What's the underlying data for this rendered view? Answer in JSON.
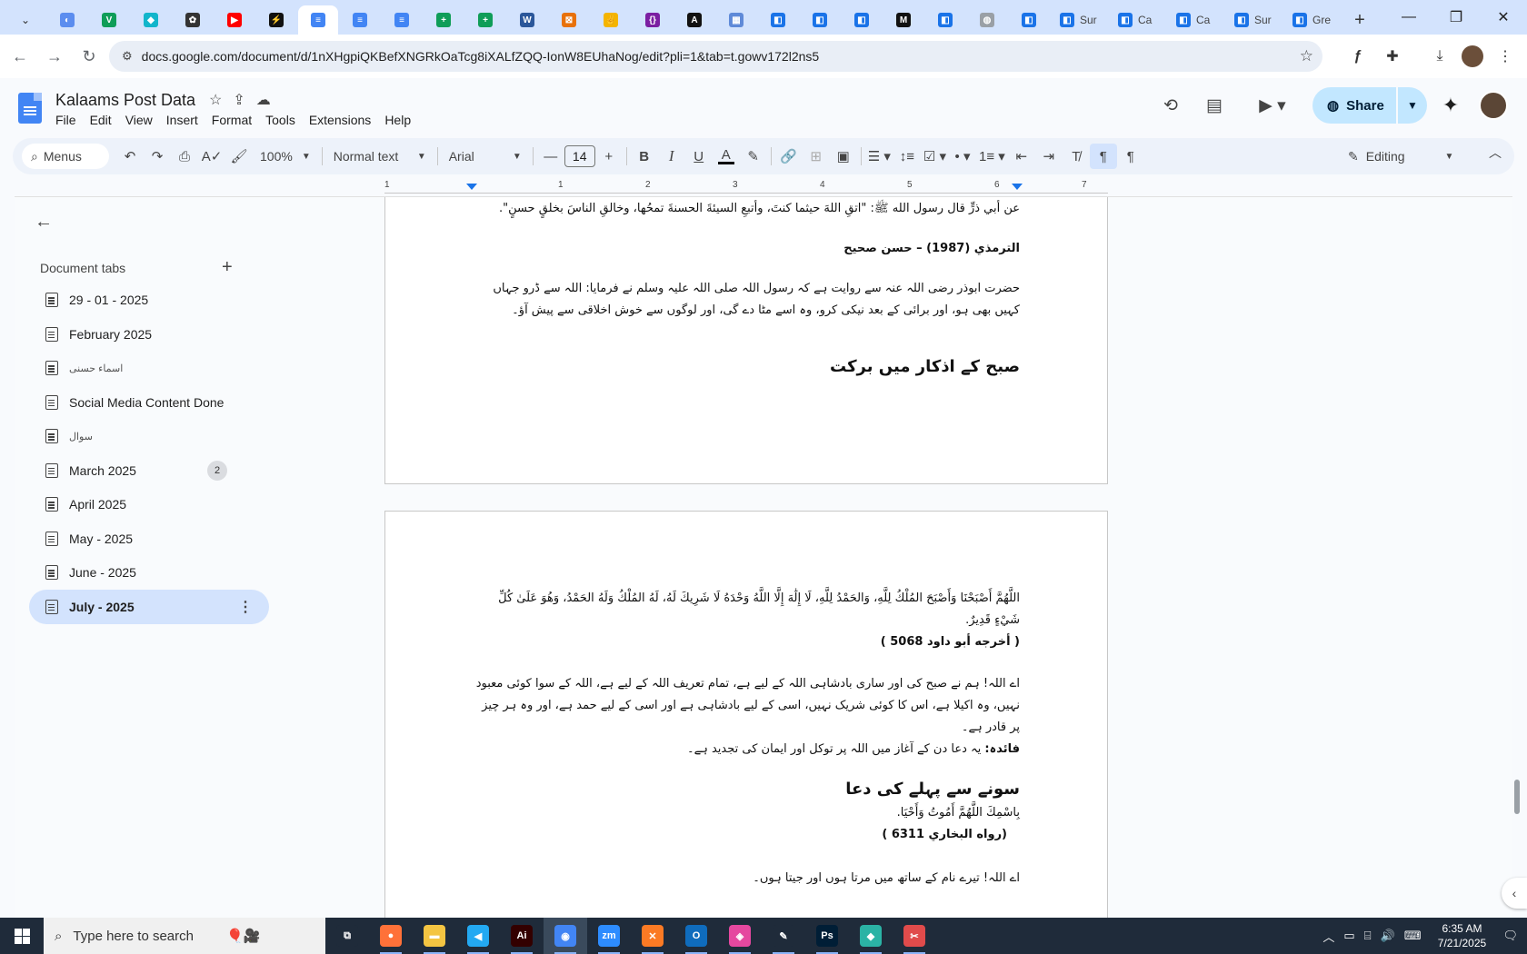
{
  "browser": {
    "tabs": [
      {
        "icon": "globe-sphere-icon",
        "color": "#5b8def",
        "label": "",
        "glyph": "◐"
      },
      {
        "icon": "v-logo-icon",
        "color": "#0f9d58",
        "label": "",
        "glyph": "V"
      },
      {
        "icon": "diamond-logo-icon",
        "color": "#12b5cb",
        "label": "",
        "glyph": "◆"
      },
      {
        "icon": "openai-icon",
        "color": "#333333",
        "label": "",
        "glyph": "✿"
      },
      {
        "icon": "youtube-icon",
        "color": "#ff0000",
        "label": "",
        "glyph": "▶"
      },
      {
        "icon": "bolt-icon",
        "color": "#111111",
        "label": "",
        "glyph": "⚡"
      },
      {
        "icon": "google-docs-icon",
        "color": "#4285f4",
        "label": "",
        "glyph": "≡",
        "active": true
      },
      {
        "icon": "google-docs-icon",
        "color": "#4285f4",
        "label": "",
        "glyph": "≡"
      },
      {
        "icon": "google-docs-icon",
        "color": "#4285f4",
        "label": "",
        "glyph": "≡"
      },
      {
        "icon": "google-sheets-icon",
        "color": "#0f9d58",
        "label": "",
        "glyph": "+"
      },
      {
        "icon": "google-sheets-icon",
        "color": "#0f9d58",
        "label": "",
        "glyph": "+"
      },
      {
        "icon": "word-icon",
        "color": "#2b579a",
        "label": "",
        "glyph": "W"
      },
      {
        "icon": "grid-logo-icon",
        "color": "#e8710a",
        "label": "",
        "glyph": "⊠"
      },
      {
        "icon": "bird-logo-icon",
        "color": "#f4b400",
        "label": "",
        "glyph": "✌"
      },
      {
        "icon": "code-braces-icon",
        "color": "#7b1fa2",
        "label": "",
        "glyph": "{}"
      },
      {
        "icon": "a-logo-icon",
        "color": "#111111",
        "label": "",
        "glyph": "A"
      },
      {
        "icon": "table-icon",
        "color": "#5f8ad8",
        "label": "",
        "glyph": "▦"
      },
      {
        "icon": "forms-icon",
        "color": "#1a73e8",
        "label": "",
        "glyph": "◧"
      },
      {
        "icon": "forms-icon",
        "color": "#1a73e8",
        "label": "",
        "glyph": "◧"
      },
      {
        "icon": "forms-icon",
        "color": "#1a73e8",
        "label": "",
        "glyph": "◧"
      },
      {
        "icon": "m-logo-icon",
        "color": "#111111",
        "label": "",
        "glyph": "M"
      },
      {
        "icon": "forms-icon",
        "color": "#1a73e8",
        "label": "",
        "glyph": "◧"
      },
      {
        "icon": "globe-icon",
        "color": "#9aa0a6",
        "label": "",
        "glyph": "◍"
      },
      {
        "icon": "forms-icon",
        "color": "#1a73e8",
        "label": "",
        "glyph": "◧"
      },
      {
        "icon": "forms-icon",
        "color": "#1a73e8",
        "label": "Sur",
        "glyph": "◧"
      },
      {
        "icon": "forms-icon",
        "color": "#1a73e8",
        "label": "Ca",
        "glyph": "◧"
      },
      {
        "icon": "forms-icon",
        "color": "#1a73e8",
        "label": "Ca",
        "glyph": "◧"
      },
      {
        "icon": "forms-icon",
        "color": "#1a73e8",
        "label": "Sur",
        "glyph": "◧"
      },
      {
        "icon": "forms-icon",
        "color": "#1a73e8",
        "label": "Gre",
        "glyph": "◧"
      }
    ],
    "url": "docs.google.com/document/d/1nXHgpiQKBefXNGRkOaTcg8iXALfZQQ-IonW8EUhaNog/edit?pli=1&tab=t.gowv172l2ns5"
  },
  "docs": {
    "title": "Kalaams Post Data",
    "menu": [
      "File",
      "Edit",
      "View",
      "Insert",
      "Format",
      "Tools",
      "Extensions",
      "Help"
    ],
    "share_label": "Share",
    "toolbar": {
      "menus_label": "Menus",
      "zoom": "100%",
      "style": "Normal text",
      "font": "Arial",
      "font_size": "14",
      "bold": "B",
      "italic": "I",
      "underline": "U",
      "text_color": "A",
      "mode": "Editing"
    },
    "ruler_numbers": [
      "1",
      "1",
      "2",
      "3",
      "4",
      "5",
      "6",
      "7"
    ]
  },
  "sidebar": {
    "heading": "Document tabs",
    "tabs": [
      {
        "label": "29 - 01 - 2025"
      },
      {
        "label": "February 2025"
      },
      {
        "label": "اسماء حسنی",
        "urdu": true
      },
      {
        "label": "Social Media Content Done"
      },
      {
        "label": "سوال",
        "urdu": true
      },
      {
        "label": "March 2025",
        "badge": "2"
      },
      {
        "label": "April 2025"
      },
      {
        "label": "May - 2025"
      },
      {
        "label": "June - 2025"
      },
      {
        "label": "July - 2025",
        "active": true
      }
    ]
  },
  "page1": {
    "hadith": "عن أبي ذرٍّ قال رسول الله ﷺ: \"اتقِ اللهَ حيثما كنتَ، وأتبعِ السيئةَ الحسنةَ تمحُها، وخالقِ الناسَ بخلقٍ حسنٍ\".",
    "ref": "الترمذي (1987) – حسن صحيح",
    "translation": "حضرت ابوذر رضی اللہ عنہ سے روایت ہے کہ رسول اللہ صلی اللہ علیہ وسلم نے فرمایا: اللہ سے ڈرو جہاں کہیں بھی ہو، اور برائی کے بعد نیکی کرو، وہ اسے مٹا دے گی، اور لوگوں سے خوش اخلاقی سے پیش آؤ۔",
    "heading": "صبح کے اذکار میں برکت"
  },
  "page2": {
    "dua": "اللَّهُمَّ أَصْبَحْنَا وَأَصْبَحَ المُلْكُ لِلَّهِ، وَالحَمْدُ لِلَّهِ، لَا إِلَٰهَ إِلَّا اللَّهُ وَحْدَهُ لَا شَرِيكَ لَهُ، لَهُ المُلْكُ وَلَهُ الحَمْدُ، وَهُوَ عَلَىٰ كُلِّ شَيْءٍ قَدِيرٌ.",
    "ref": "( أخرجه أبو داود 5068 )",
    "translation": "اے اللہ! ہم نے صبح کی اور ساری بادشاہی اللہ کے لیے ہے، تمام تعریف اللہ کے لیے ہے، اللہ کے سوا کوئی معبود نہیں، وہ اکیلا ہے، اس کا کوئی شریک نہیں، اسی کے لیے بادشاہی ہے اور اسی کے لیے حمد ہے، اور وہ ہر چیز پر قادر ہے۔",
    "benefit_label": "فائدہ:",
    "benefit": "یہ دعا دن کے آغاز میں اللہ پر توکل اور ایمان کی تجدید ہے۔",
    "heading2": "سونے سے پہلے کی دعا",
    "dua2": "بِاسْمِكَ اللَّهُمَّ أَمُوتُ وَأَحْيَا.",
    "ref2": "(رواه البخاري 6311 )",
    "translation2": "اے اللہ! تیرے نام کے ساتھ میں مرتا ہوں اور جیتا ہوں۔"
  },
  "taskbar": {
    "search_placeholder": "Type here to search",
    "time": "6:35 AM",
    "date": "7/21/2025",
    "apps": [
      {
        "icon": "task-view-icon",
        "color": "#1f2b3a",
        "glyph": "⧉"
      },
      {
        "icon": "firefox-icon",
        "color": "#ff7139",
        "glyph": "●"
      },
      {
        "icon": "file-explorer-icon",
        "color": "#f4c542",
        "glyph": "▬"
      },
      {
        "icon": "vscode-icon",
        "color": "#23a9f2",
        "glyph": "◀"
      },
      {
        "icon": "illustrator-icon",
        "color": "#330000",
        "glyph": "Ai"
      },
      {
        "icon": "chrome-icon",
        "color": "#4285f4",
        "glyph": "◉",
        "current": true
      },
      {
        "icon": "zoom-icon",
        "color": "#2d8cff",
        "glyph": "zm"
      },
      {
        "icon": "xampp-icon",
        "color": "#fb7a24",
        "glyph": "✕"
      },
      {
        "icon": "outlook-icon",
        "color": "#0f6cbd",
        "glyph": "O"
      },
      {
        "icon": "photo-app-icon",
        "color": "#e5489f",
        "glyph": "◈"
      },
      {
        "icon": "pen-tool-icon",
        "color": "#1f2b3a",
        "glyph": "✎"
      },
      {
        "icon": "photoshop-icon",
        "color": "#001e36",
        "glyph": "Ps"
      },
      {
        "icon": "cube-app-icon",
        "color": "#2bb3a5",
        "glyph": "◆"
      },
      {
        "icon": "snipping-tool-icon",
        "color": "#e04b4b",
        "glyph": "✂"
      }
    ]
  }
}
